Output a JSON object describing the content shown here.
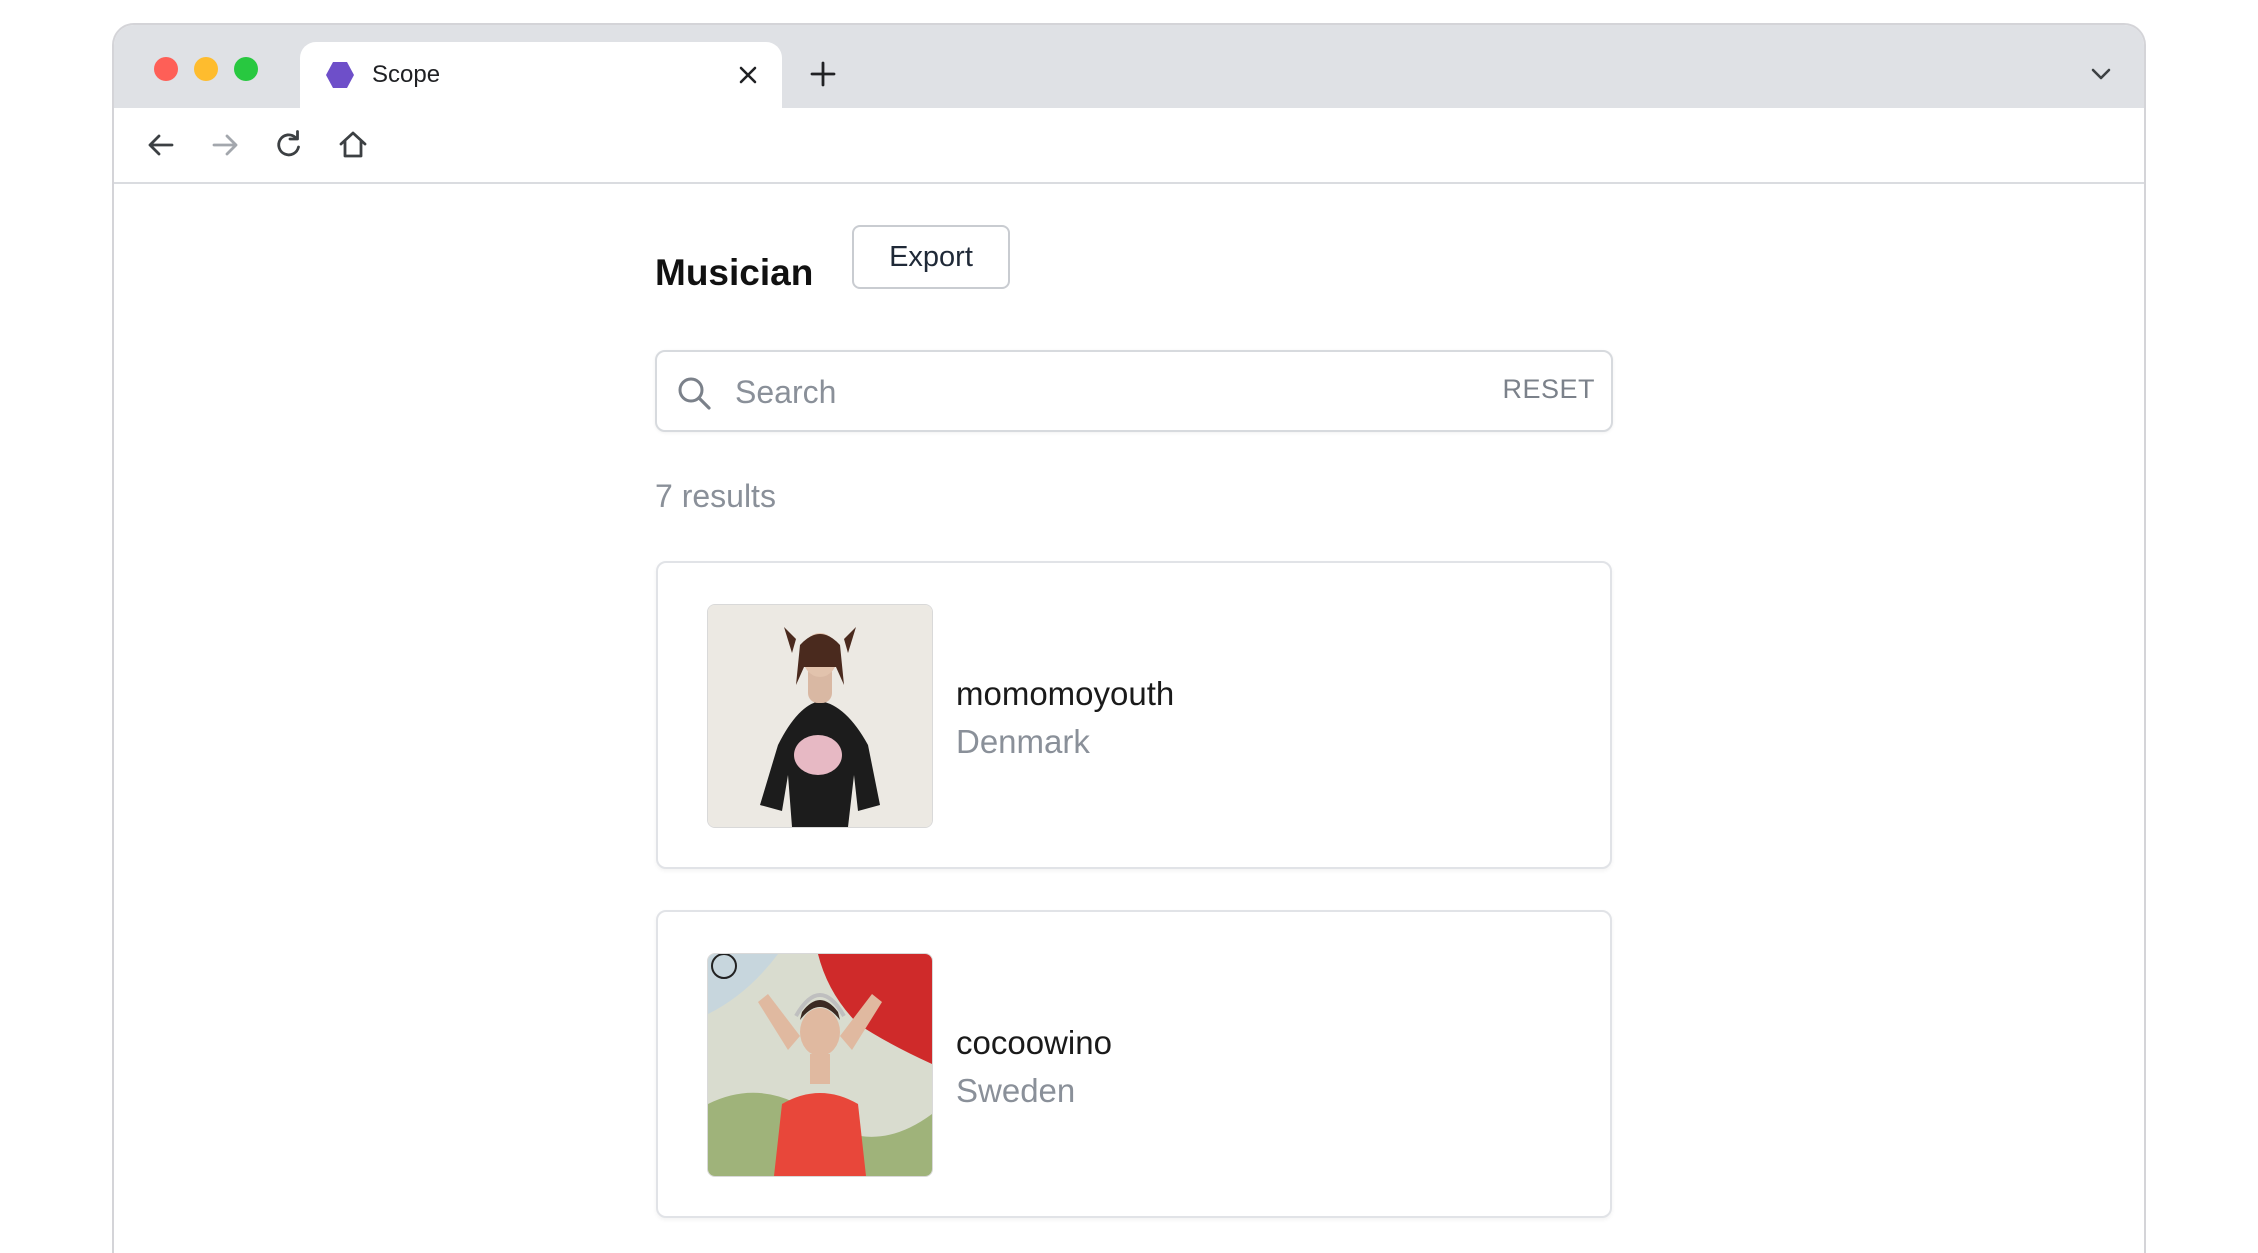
{
  "browser": {
    "tab": {
      "title": "Scope",
      "favicon": "purple-hexagon-icon"
    },
    "new_tab_icon": "plus-icon",
    "tab_list_icon": "chevron-down-icon",
    "nav": {
      "back_icon": "arrow-left-icon",
      "forward_icon": "arrow-right-icon",
      "reload_icon": "reload-icon",
      "home_icon": "home-icon"
    },
    "colors": {
      "close": "#fe5f57",
      "minimize": "#febc2e",
      "zoom": "#28c840",
      "favicon": "#6e4fc9"
    }
  },
  "page": {
    "title": "Musician",
    "export_label": "Export",
    "search": {
      "placeholder": "Search",
      "value": "",
      "reset_label": "RESET"
    },
    "results_label": "7 results",
    "cards": [
      {
        "name": "momomoyouth",
        "country": "Denmark"
      },
      {
        "name": "cocoowino",
        "country": "Sweden"
      }
    ]
  }
}
